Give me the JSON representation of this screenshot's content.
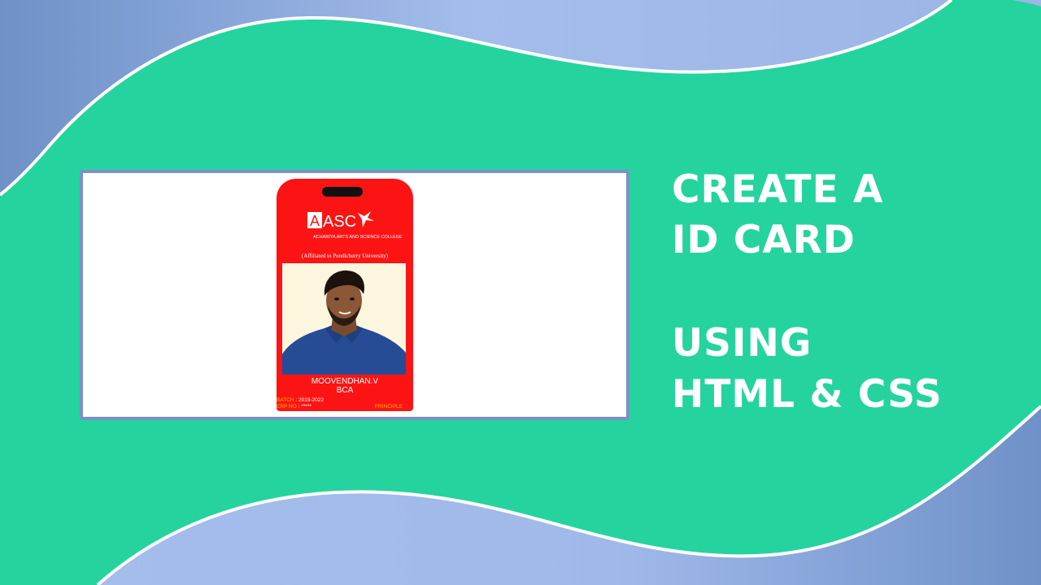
{
  "colors": {
    "background_green": "#25d39f",
    "wave_blue": "#a4bdeb",
    "wave_blue_dark": "#6f91c8",
    "frame_border": "#7d90c9",
    "card_red": "#fc1414",
    "label_gold": "#f6b800"
  },
  "headline": {
    "line1": "CREATE A",
    "line2": "ID CARD",
    "line3": "USING",
    "line4": "HTML & CSS"
  },
  "card": {
    "logo_text": "ASC",
    "logo_mark": "A",
    "college_name": "ACHARIYA ARTS AND SCIENCE COLLEGE",
    "affiliation": "(Affiliated to Pondicherry University)",
    "student_name": "MOOVENDHAN.V",
    "course": "BCA",
    "batch_label": "BATCH",
    "batch_value": " : 2019-2022",
    "erp_label": "ERP NO",
    "erp_value": " : *****",
    "principal_label": "PRINCIPLE"
  },
  "icons": {
    "logo": "college-logo-icon",
    "photo": "student-photo"
  }
}
